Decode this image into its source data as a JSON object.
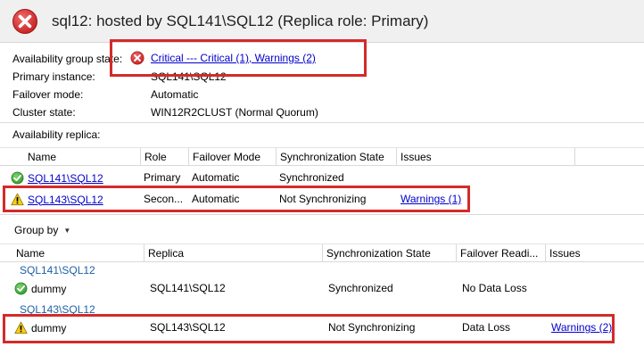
{
  "header": {
    "title": "sql12: hosted by SQL141\\SQL12 (Replica role: Primary)",
    "icon": "error-icon",
    "icon_color": "#d42a2a"
  },
  "properties": [
    {
      "label": "Availability group state:",
      "value": "Critical --- Critical (1), Warnings (2)",
      "icon": "error-icon",
      "is_link": true
    },
    {
      "label": "Primary instance:",
      "value": "SQL141\\SQL12"
    },
    {
      "label": "Failover mode:",
      "value": "Automatic"
    },
    {
      "label": "Cluster state:",
      "value": "WIN12R2CLUST (Normal Quorum)"
    }
  ],
  "replicas_section_label": "Availability replica:",
  "replica_columns": [
    "Name",
    "Role",
    "Failover Mode",
    "Synchronization State",
    "Issues"
  ],
  "replicas": [
    {
      "name": "SQL141\\SQL12",
      "status_icon": "check-icon",
      "role": "Primary",
      "failover_mode": "Automatic",
      "sync_state": "Synchronized",
      "issues": ""
    },
    {
      "name": "SQL143\\SQL12",
      "status_icon": "warning-icon",
      "role": "Secon...",
      "failover_mode": "Automatic",
      "sync_state": "Not Synchronizing",
      "issues": "Warnings (1)"
    }
  ],
  "group_by_label": "Group by",
  "db_columns": [
    "Name",
    "Replica",
    "Synchronization State",
    "Failover Readi...",
    "Issues"
  ],
  "db_groups": [
    {
      "title": "SQL141\\SQL12",
      "rows": [
        {
          "name": "dummy",
          "status_icon": "check-icon",
          "replica": "SQL141\\SQL12",
          "sync_state": "Synchronized",
          "failover_readiness": "No Data Loss",
          "issues": ""
        }
      ]
    },
    {
      "title": "SQL143\\SQL12",
      "rows": [
        {
          "name": "dummy",
          "status_icon": "warning-icon",
          "replica": "SQL143\\SQL12",
          "sync_state": "Not Synchronizing",
          "failover_readiness": "Data Loss",
          "issues": "Warnings (2)"
        }
      ]
    }
  ],
  "colors": {
    "link": "#0000cc",
    "highlight": "#d42a2a",
    "ok": "#3aa63a",
    "warning": "#f2c400"
  }
}
